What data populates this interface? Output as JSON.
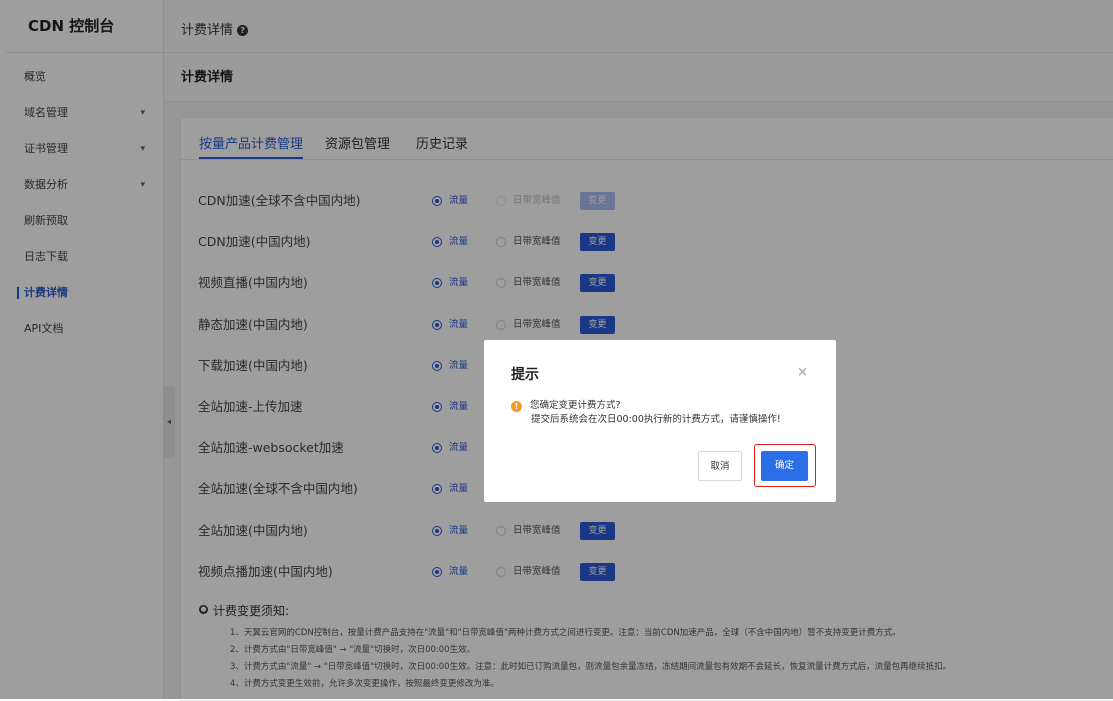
{
  "sidebar": {
    "brand": "CDN 控制台",
    "items": [
      {
        "label": "概览",
        "caret": ""
      },
      {
        "label": "域名管理",
        "caret": "▾"
      },
      {
        "label": "证书管理",
        "caret": "▾"
      },
      {
        "label": "数据分析",
        "caret": "▾"
      },
      {
        "label": "刷新预取",
        "caret": ""
      },
      {
        "label": "日志下载",
        "caret": ""
      },
      {
        "label": "计费详情",
        "caret": "",
        "active": true
      },
      {
        "label": "API文档",
        "caret": ""
      }
    ],
    "collapse_glyph": "◂"
  },
  "header": {
    "title": "计费详情",
    "help_glyph": "?"
  },
  "subheader": {
    "title": "计费详情"
  },
  "tabs": [
    {
      "label": "按量产品计费管理",
      "active": true
    },
    {
      "label": "资源包管理",
      "active": false
    },
    {
      "label": "历史记录",
      "active": false
    }
  ],
  "billing": {
    "option_traffic": "流量",
    "option_bandwidth": "日带宽峰值",
    "change_label": "变更",
    "rows": [
      {
        "name": "CDN加速(全球不含中国内地)",
        "selected": "traffic",
        "change_enabled": false,
        "bandwidth_enabled": false
      },
      {
        "name": "CDN加速(中国内地)",
        "selected": "traffic",
        "change_enabled": true,
        "bandwidth_enabled": true
      },
      {
        "name": "视频直播(中国内地)",
        "selected": "traffic",
        "change_enabled": true,
        "bandwidth_enabled": true
      },
      {
        "name": "静态加速(中国内地)",
        "selected": "traffic",
        "change_enabled": true,
        "bandwidth_enabled": true
      },
      {
        "name": "下载加速(中国内地)",
        "selected": "traffic",
        "change_enabled": true,
        "bandwidth_enabled": true
      },
      {
        "name": "全站加速-上传加速",
        "selected": "traffic",
        "change_enabled": true,
        "bandwidth_enabled": true
      },
      {
        "name": "全站加速-websocket加速",
        "selected": "traffic",
        "change_enabled": true,
        "bandwidth_enabled": true
      },
      {
        "name": "全站加速(全球不含中国内地)",
        "selected": "traffic",
        "change_enabled": true,
        "bandwidth_enabled": true
      },
      {
        "name": "全站加速(中国内地)",
        "selected": "traffic",
        "change_enabled": true,
        "bandwidth_enabled": true
      },
      {
        "name": "视频点播加速(中国内地)",
        "selected": "traffic",
        "change_enabled": true,
        "bandwidth_enabled": true
      }
    ]
  },
  "notice": {
    "title": "计费变更须知:",
    "lines": [
      "1、天翼云官网的CDN控制台，按量计费产品支持在\"流量\"和\"日带宽峰值\"两种计费方式之间进行变更。注意：当前CDN加速产品，全球（不含中国内地）暂不支持变更计费方式。",
      "2、计费方式由\"日带宽峰值\" → \"流量\"切换时，次日00:00生效。",
      "3、计费方式由\"流量\" → \"日带宽峰值\"切换时，次日00:00生效。注意：此时如已订购流量包，则流量包余量冻结，冻结期间流量包有效期不会延长，恢复流量计费方式后，流量包再继续抵扣。",
      "4、计费方式变更生效前，允许多次变更操作，按照最终变更修改为准。"
    ]
  },
  "dialog": {
    "title": "提示",
    "close_glyph": "×",
    "warn_glyph": "!",
    "message_line1": "您确定变更计费方式?",
    "message_line2": "提交后系统会在次日00:00执行新的计费方式，请谨慎操作!",
    "cancel_label": "取消",
    "ok_label": "确定"
  },
  "colors": {
    "accent": "#2a5bd7",
    "warning": "#f59a23",
    "highlight": "#e02020"
  }
}
